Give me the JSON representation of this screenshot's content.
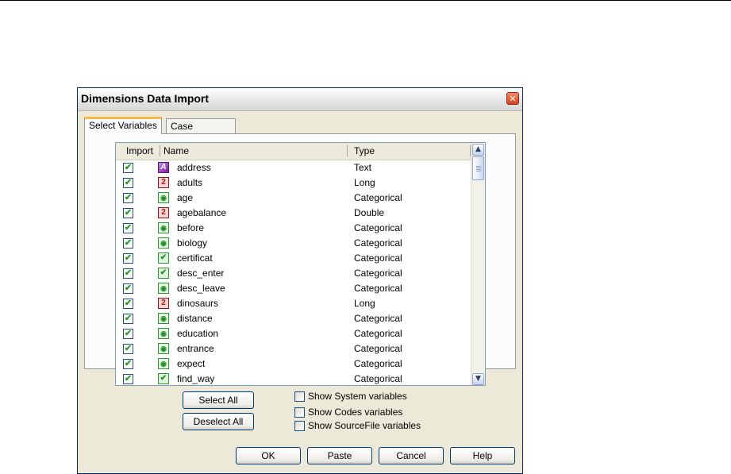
{
  "dialog": {
    "title": "Dimensions Data Import",
    "close_glyph": "✕"
  },
  "tabs": [
    {
      "label": "Select Variables",
      "active": true
    },
    {
      "label": "Case Selection",
      "active": false
    }
  ],
  "table": {
    "columns": {
      "import": "Import",
      "name": "Name",
      "type": "Type"
    },
    "rows": [
      {
        "import": true,
        "icon": "text-variable-icon",
        "name": "address",
        "type": "Text"
      },
      {
        "import": true,
        "icon": "numeric-variable-icon",
        "name": "adults",
        "type": "Long"
      },
      {
        "import": true,
        "icon": "categorical-variable-icon",
        "name": "age",
        "type": "Categorical"
      },
      {
        "import": true,
        "icon": "numeric-variable-icon",
        "name": "agebalance",
        "type": "Double"
      },
      {
        "import": true,
        "icon": "categorical-variable-icon",
        "name": "before",
        "type": "Categorical"
      },
      {
        "import": true,
        "icon": "categorical-variable-icon",
        "name": "biology",
        "type": "Categorical"
      },
      {
        "import": true,
        "icon": "boolean-variable-icon",
        "name": "certificat",
        "type": "Categorical"
      },
      {
        "import": true,
        "icon": "boolean-variable-icon",
        "name": "desc_enter",
        "type": "Categorical"
      },
      {
        "import": true,
        "icon": "categorical-variable-icon",
        "name": "desc_leave",
        "type": "Categorical"
      },
      {
        "import": true,
        "icon": "numeric-variable-icon",
        "name": "dinosaurs",
        "type": "Long"
      },
      {
        "import": true,
        "icon": "categorical-variable-icon",
        "name": "distance",
        "type": "Categorical"
      },
      {
        "import": true,
        "icon": "categorical-variable-icon",
        "name": "education",
        "type": "Categorical"
      },
      {
        "import": true,
        "icon": "categorical-variable-icon",
        "name": "entrance",
        "type": "Categorical"
      },
      {
        "import": true,
        "icon": "categorical-variable-icon",
        "name": "expect",
        "type": "Categorical"
      },
      {
        "import": true,
        "icon": "boolean-variable-icon",
        "name": "find_way",
        "type": "Categorical"
      }
    ]
  },
  "icon_glyphs": {
    "text-variable-icon": "A",
    "numeric-variable-icon": "2",
    "categorical-variable-icon": "◉",
    "boolean-variable-icon": "✔"
  },
  "check_glyph": "✔",
  "buttons": {
    "select_all": "Select All",
    "deselect_all": "Deselect All",
    "ok": "OK",
    "paste": "Paste",
    "cancel": "Cancel",
    "help": "Help"
  },
  "options": [
    {
      "label": "Show System variables",
      "checked": false
    },
    {
      "label": "Show Codes variables",
      "checked": false
    },
    {
      "label": "Show SourceFile variables",
      "checked": false
    }
  ],
  "scrollbar_glyphs": {
    "up": "▲",
    "down": "▼"
  }
}
